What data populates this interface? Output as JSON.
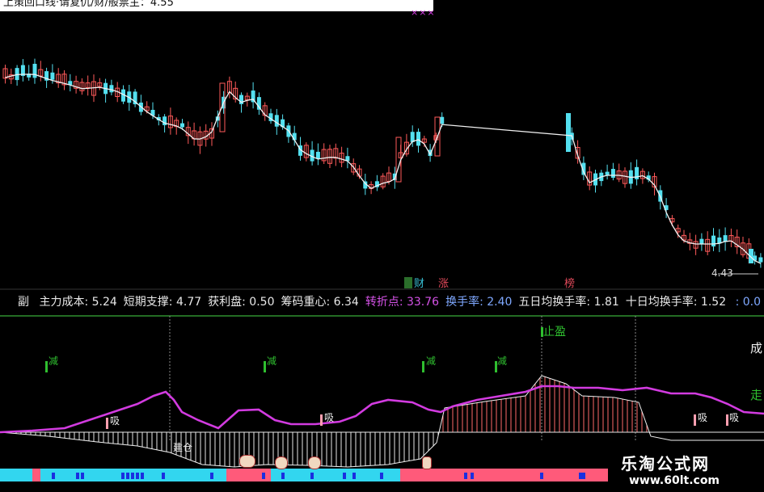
{
  "header": {
    "title": "上策回口线·请复仇/财/般票主：4.55",
    "mark": "×××"
  },
  "price_chart": {
    "last_price_label": "4.43",
    "event_tags": [
      {
        "text": "财",
        "color": "#39c1d6"
      },
      {
        "text": "涨",
        "color": "#e04a5a"
      },
      {
        "text": "榜",
        "color": "#e04a5a"
      }
    ]
  },
  "indicator_bar": {
    "prefix": "副",
    "items": [
      {
        "label": "主力成本:",
        "value": "5.24",
        "color": "#e8e8e8"
      },
      {
        "label": "短期支撑:",
        "value": "4.77",
        "color": "#e8e8e8"
      },
      {
        "label": "获利盘:",
        "value": "0.50",
        "color": "#e8e8e8"
      },
      {
        "label": "筹码重心:",
        "value": "6.34",
        "color": "#e8e8e8"
      },
      {
        "label": "转折点:",
        "value": "33.76",
        "color": "#d452e6"
      },
      {
        "label": "换手率:",
        "value": "2.40",
        "color": "#7fa8ff"
      },
      {
        "label": "五日均换手率:",
        "value": "1.81",
        "color": "#e8e8e8"
      },
      {
        "label": "十日均换手率:",
        "value": "1.52",
        "color": "#e8e8e8"
      }
    ],
    "right_value": ": 0.0"
  },
  "sub_chart": {
    "labels": {
      "jian": "减",
      "xi": "吸",
      "jiancang": "建仓",
      "zhiying": "止盈",
      "cheng": "成",
      "zou": "走"
    }
  },
  "brand": {
    "name": "乐淘公式网",
    "url": "www.60lt.com"
  },
  "colors": {
    "up": "#ff5a5a",
    "down": "#54e0f0",
    "magenta": "#d23be0",
    "green": "#2fbf2f",
    "strip_red": "#ff5a7a",
    "strip_cyan": "#32d6ef"
  }
}
